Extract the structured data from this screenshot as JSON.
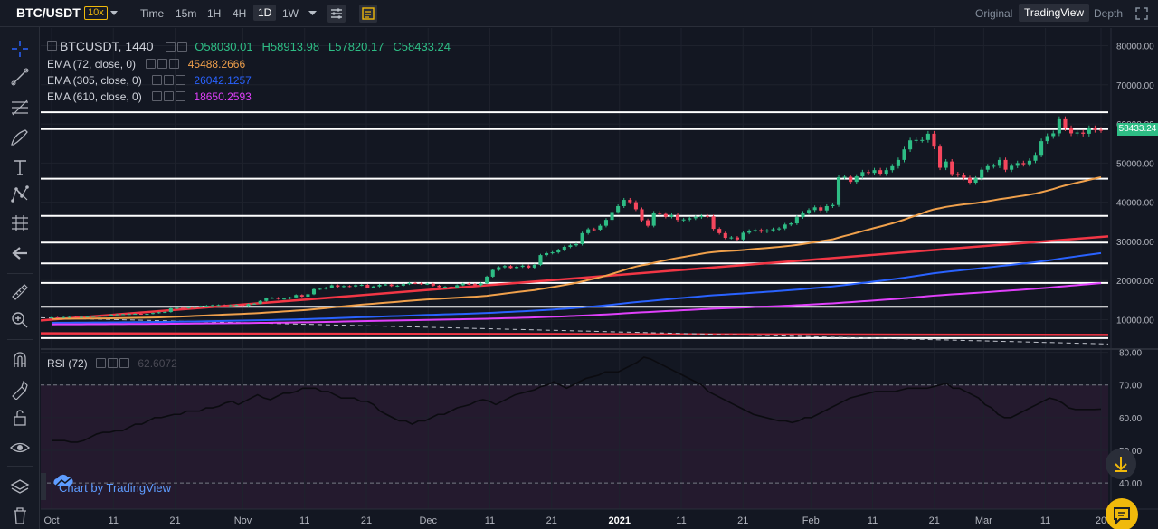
{
  "toolbar": {
    "pair": "BTC/USDT",
    "leverage": "10x",
    "intervals": [
      "Time",
      "15m",
      "1H",
      "4H",
      "1D",
      "1W"
    ],
    "active_interval": "1D",
    "views": [
      "Original",
      "TradingView",
      "Depth"
    ],
    "active_view": "TradingView"
  },
  "legend": {
    "symbol": "BTCUSDT, 1440",
    "open": "O58030.01",
    "high": "H58913.98",
    "low": "L57820.17",
    "close": "C58433.24",
    "ema": [
      {
        "label": "EMA (72, close, 0)",
        "value": "45488.2666",
        "color": "#f0a04b"
      },
      {
        "label": "EMA (305, close, 0)",
        "value": "26042.1257",
        "color": "#2962ff"
      },
      {
        "label": "EMA (610, close, 0)",
        "value": "18650.2593",
        "color": "#e040fb"
      }
    ],
    "rsi_label": "RSI (72)",
    "rsi_value": "62.6072"
  },
  "last_price": "58433.24",
  "credit": "Chart by TradingView",
  "colors": {
    "up": "#2ebd85",
    "down": "#f6465d",
    "bg": "#131722",
    "rsi_band": "#241a2e",
    "hline": "#ffffff",
    "red_trend": "#f23645"
  },
  "chart_data": {
    "type": "candlestick",
    "price_axis": {
      "ticks": [
        "80000.00",
        "70000.00",
        "60000.00",
        "50000.00",
        "40000.00",
        "30000.00",
        "20000.00",
        "10000.00"
      ],
      "tick_values": [
        80000,
        70000,
        60000,
        50000,
        40000,
        30000,
        20000,
        10000
      ],
      "ylim": [
        2500,
        84500
      ]
    },
    "rsi_axis": {
      "ticks": [
        "80.00",
        "70.00",
        "60.00",
        "50.00",
        "40.00"
      ],
      "tick_values": [
        80,
        70,
        60,
        50,
        40
      ],
      "ylim": [
        32,
        81
      ],
      "band": [
        30,
        70
      ]
    },
    "time_axis": {
      "labels": [
        "Oct",
        "11",
        "21",
        "Nov",
        "11",
        "21",
        "Dec",
        "11",
        "21",
        "2021",
        "11",
        "21",
        "Feb",
        "11",
        "21",
        "Mar",
        "11",
        "20"
      ],
      "days": [
        0,
        10,
        20,
        31,
        41,
        51,
        61,
        71,
        81,
        92,
        102,
        112,
        123,
        133,
        143,
        151,
        161,
        170
      ],
      "bold": [
        "2021"
      ]
    },
    "total_days": 170,
    "horizontal_levels": [
      63000,
      58700,
      46000,
      36500,
      29700,
      24400,
      19400,
      13300,
      5300
    ],
    "close": [
      10600,
      10550,
      10650,
      10700,
      10600,
      10700,
      10850,
      10900,
      10950,
      11000,
      11300,
      11350,
      11400,
      11450,
      11500,
      11450,
      11500,
      11700,
      11900,
      11950,
      12900,
      13000,
      12950,
      13100,
      13250,
      13450,
      13600,
      13700,
      13750,
      13550,
      13700,
      13800,
      13550,
      14000,
      14100,
      14800,
      15500,
      15600,
      15300,
      15400,
      15700,
      16300,
      15900,
      16500,
      17800,
      17900,
      18200,
      18800,
      18400,
      18600,
      18500,
      18800,
      18900,
      18200,
      18500,
      18900,
      19000,
      18600,
      18700,
      19100,
      19400,
      19300,
      19100,
      19200,
      18700,
      18300,
      18400,
      18200,
      18800,
      19200,
      19100,
      18800,
      19300,
      21000,
      22700,
      23400,
      23700,
      23200,
      23500,
      23800,
      23300,
      24000,
      26500,
      27000,
      27200,
      27800,
      28600,
      29000,
      29300,
      32100,
      33100,
      33000,
      34000,
      35500,
      37500,
      39000,
      40600,
      40000,
      38200,
      35400,
      34000,
      37300,
      37000,
      36300,
      36700,
      35500,
      35600,
      35900,
      36200,
      36500,
      36400,
      33200,
      32100,
      30900,
      31000,
      30500,
      32200,
      32700,
      32900,
      32500,
      32800,
      33100,
      33300,
      34300,
      34600,
      36200,
      37300,
      38000,
      38700,
      37900,
      39000,
      39300,
      46400,
      46500,
      45200,
      46600,
      47700,
      47500,
      48200,
      47300,
      48200,
      49200,
      50800,
      53500,
      55800,
      55900,
      55900,
      57500,
      54200,
      48800,
      50400,
      47200,
      47000,
      46200,
      45000,
      46100,
      48300,
      49200,
      49300,
      50800,
      48300,
      49300,
      50000,
      49700,
      50600,
      52100,
      55600,
      56900,
      57600,
      61200,
      58900,
      57600,
      57800,
      57500,
      58900,
      58500,
      58433
    ],
    "rsi": [
      53,
      53,
      53,
      52.5,
      52.5,
      53,
      54,
      55,
      55.5,
      55.5,
      56,
      56,
      57,
      58,
      58,
      59,
      60,
      60,
      60.5,
      61,
      61,
      62,
      62,
      62,
      63,
      63,
      63.5,
      64.5,
      65,
      64,
      65,
      66,
      67,
      66,
      65.5,
      66.5,
      67.5,
      67.5,
      68,
      69,
      69,
      69,
      68,
      68,
      67,
      66,
      66,
      66,
      65,
      65,
      64,
      62,
      61,
      60,
      59,
      59,
      58,
      59,
      59,
      60,
      61,
      61,
      62,
      63,
      63.5,
      64,
      65,
      65.5,
      65,
      64,
      65,
      66,
      67,
      67.5,
      68,
      68.5,
      69.5,
      70,
      71,
      70,
      69,
      70,
      71,
      72,
      72.5,
      73,
      74,
      74,
      74,
      75,
      76,
      77,
      78.5,
      78,
      77,
      76,
      75,
      74,
      73,
      72,
      71,
      70,
      68,
      67,
      66,
      65,
      64,
      63,
      62,
      61,
      60.5,
      60,
      59.5,
      59,
      59,
      58.5,
      59,
      60,
      60,
      61,
      62,
      63,
      64,
      65,
      66,
      66.5,
      67,
      67.5,
      68,
      68,
      68,
      68,
      68.5,
      69,
      69,
      69,
      69,
      69.5,
      70,
      70.5,
      69,
      69,
      68,
      67,
      66,
      64,
      63,
      61,
      60,
      60,
      61,
      62,
      63,
      64,
      65,
      66,
      65.5,
      64.5,
      63,
      62.5,
      62.5,
      62.5,
      62.5,
      62.6
    ]
  }
}
